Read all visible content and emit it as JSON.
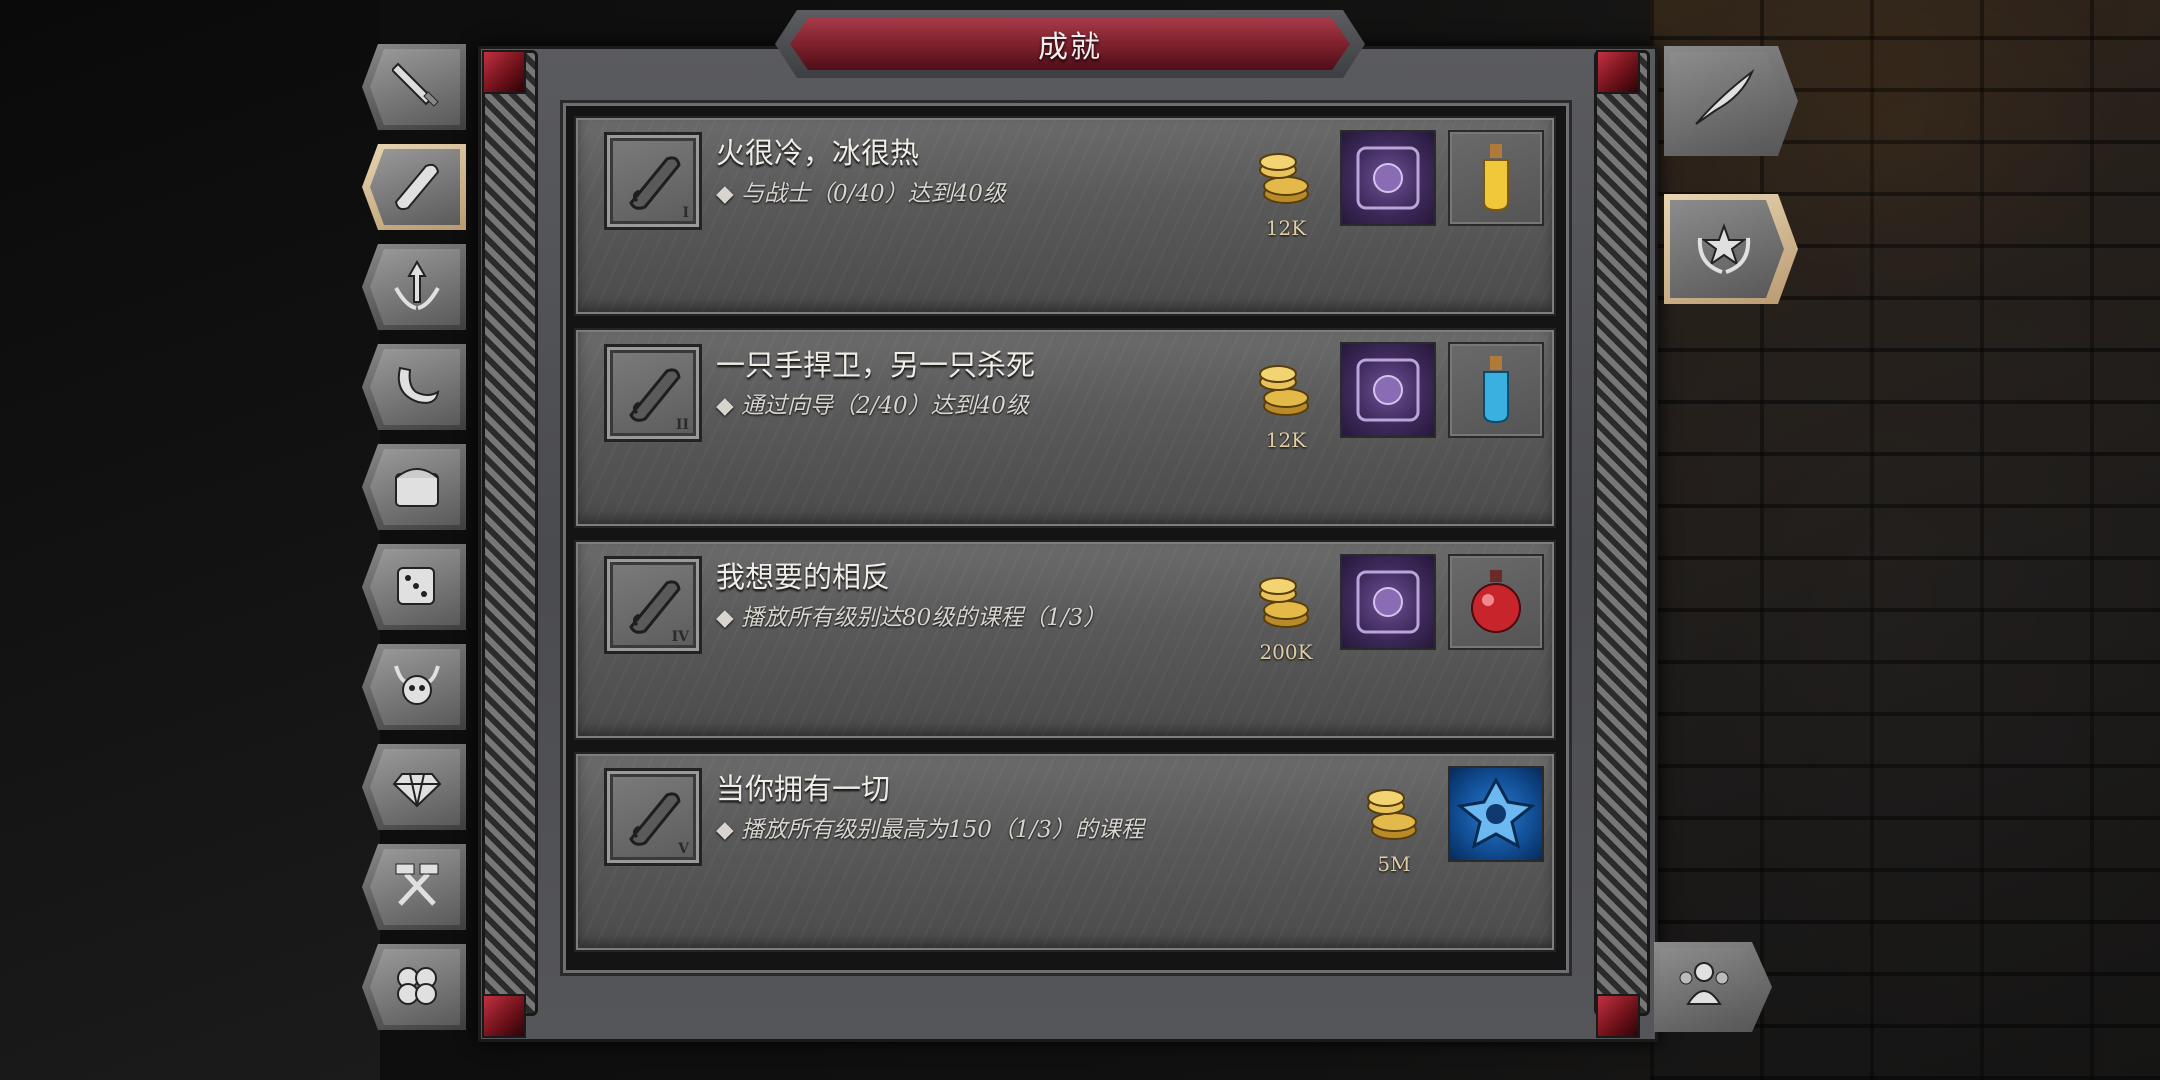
{
  "window": {
    "title": "成就"
  },
  "achievements": [
    {
      "title": "火很冷，冰很热",
      "desc": "◆ 与战士（0/40）达到40级",
      "rank": "I",
      "gold": "12K",
      "rewards": [
        "cube",
        "yellow-potion"
      ]
    },
    {
      "title": "一只手捍卫，另一只杀死",
      "desc": "◆ 通过向导（2/40）达到40级",
      "rank": "II",
      "gold": "12K",
      "rewards": [
        "cube",
        "blue-potion"
      ]
    },
    {
      "title": "我想要的相反",
      "desc": "◆ 播放所有级别达80级的课程（1/3）",
      "rank": "IV",
      "gold": "200K",
      "rewards": [
        "cube",
        "red-potion"
      ]
    },
    {
      "title": "当你拥有一切",
      "desc": "◆ 播放所有级别最高为150（1/3）的课程",
      "rank": "V",
      "gold": "5M",
      "rewards": [
        "blue-rune"
      ]
    }
  ],
  "left_tabs": [
    {
      "icon": "sword-icon",
      "active": false
    },
    {
      "icon": "scroll-icon",
      "active": true
    },
    {
      "icon": "winged-arrow-icon",
      "active": false
    },
    {
      "icon": "horn-icon",
      "active": false
    },
    {
      "icon": "chest-icon",
      "active": false
    },
    {
      "icon": "dice-icon",
      "active": false
    },
    {
      "icon": "horned-skull-icon",
      "active": false
    },
    {
      "icon": "gem-icon",
      "active": false
    },
    {
      "icon": "hammers-icon",
      "active": false
    },
    {
      "icon": "clover-icon",
      "active": false
    }
  ],
  "right_tabs": [
    {
      "icon": "quill-icon",
      "active": false
    },
    {
      "icon": "laurel-star-icon",
      "active": true
    },
    {
      "icon": "group-icon",
      "active": false
    }
  ],
  "colors": {
    "title_red": "#7a1f2b",
    "active_tab": "#d8c29c",
    "gold_text": "#e0cfa4"
  }
}
